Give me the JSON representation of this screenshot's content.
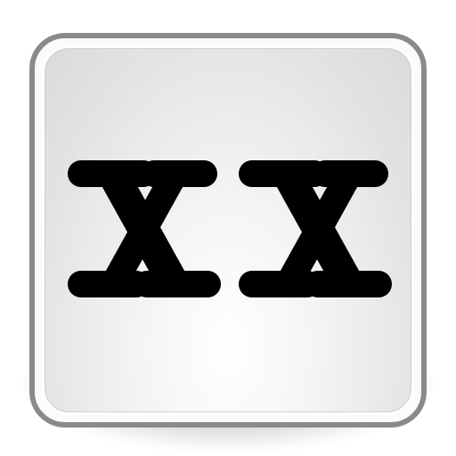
{
  "icon": {
    "name": "xx-tile-icon",
    "glyph_text": "XX",
    "colors": {
      "border": "#8a8a8a",
      "tile_light": "#ffffff",
      "tile_dark": "#dadada",
      "glyph": "#000000"
    }
  }
}
